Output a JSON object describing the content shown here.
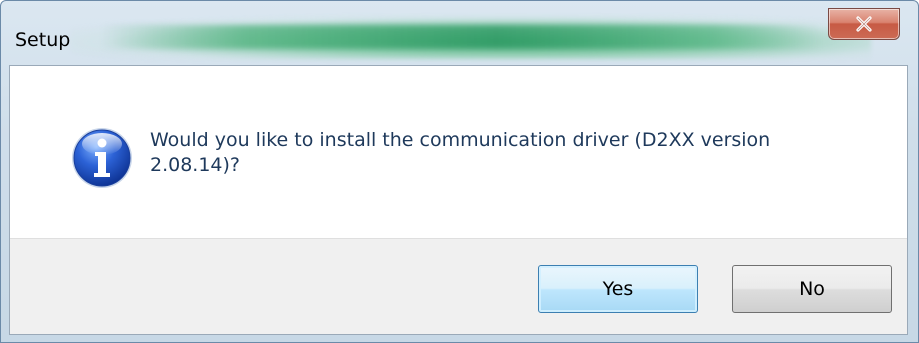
{
  "window": {
    "title": "Setup"
  },
  "titlebar": {
    "close_icon": "close-icon"
  },
  "message": {
    "icon": "info-icon",
    "text": "Would you like to install the communication driver (D2XX version 2.08.14)?"
  },
  "buttons": {
    "yes_label": "Yes",
    "no_label": "No"
  },
  "colors": {
    "message_text": "#1e395b",
    "button_bar": "#f0f0f0",
    "close_button": "#c75a44",
    "default_button_border": "#3c7fb1"
  }
}
